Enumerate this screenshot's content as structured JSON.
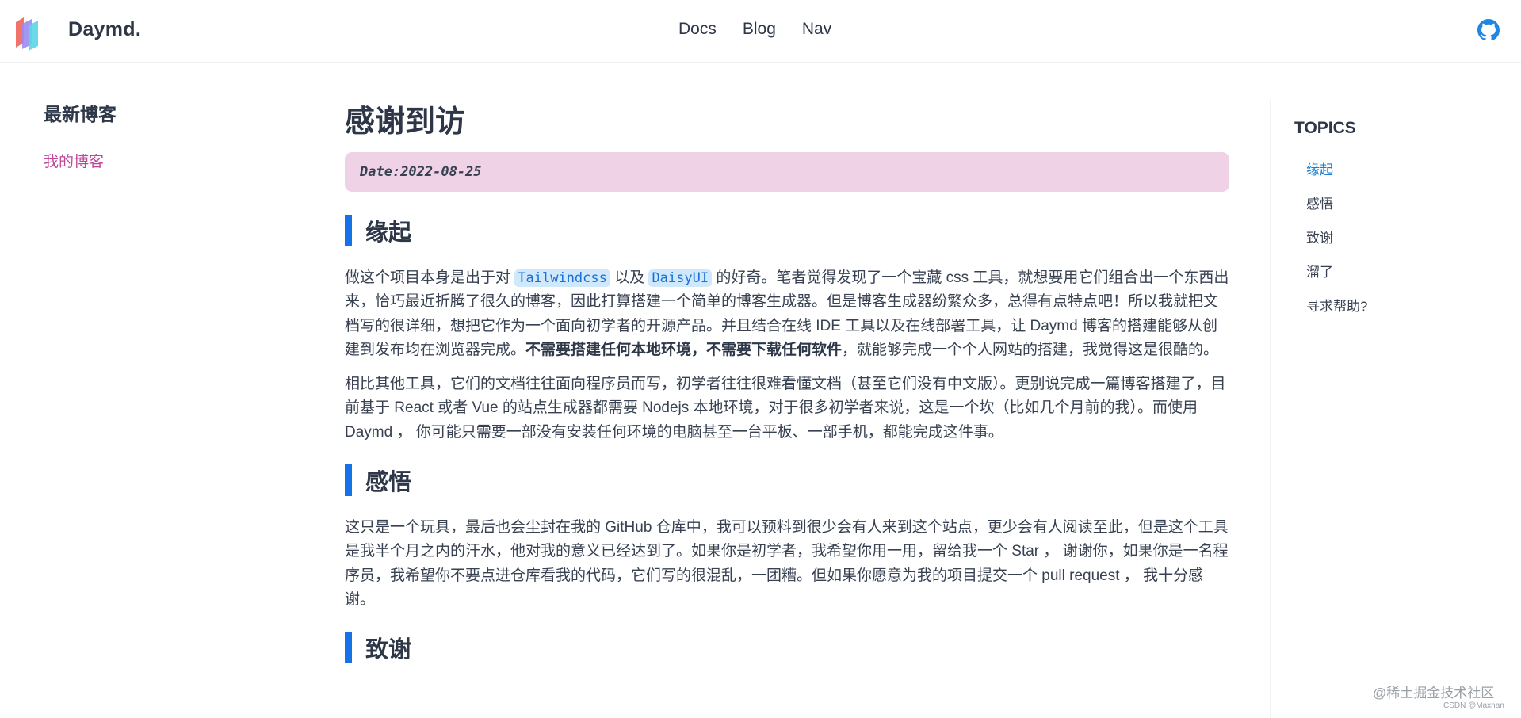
{
  "header": {
    "brand": "Daymd.",
    "nav": [
      "Docs",
      "Blog",
      "Nav"
    ]
  },
  "sidebar": {
    "title": "最新博客",
    "link": "我的博客"
  },
  "article": {
    "title": "感谢到访",
    "date": "Date:2022-08-25",
    "sections": {
      "s1_heading": "缘起",
      "s1_p1_a": "做这个项目本身是出于对 ",
      "s1_code1": "Tailwindcss",
      "s1_p1_b": " 以及 ",
      "s1_code2": "DaisyUI",
      "s1_p1_c": " 的好奇。笔者觉得发现了一个宝藏 css 工具，就想要用它们组合出一个东西出来，恰巧最近折腾了很久的博客，因此打算搭建一个简单的博客生成器。但是博客生成器纷繁众多，总得有点特点吧！所以我就把文档写的很详细，想把它作为一个面向初学者的开源产品。并且结合在线 IDE 工具以及在线部署工具，让 Daymd 博客的搭建能够从创建到发布均在浏览器完成。",
      "s1_p1_strong": "不需要搭建任何本地环境，不需要下载任何软件",
      "s1_p1_d": "，就能够完成一个个人网站的搭建，我觉得这是很酷的。",
      "s1_p2": "相比其他工具，它们的文档往往面向程序员而写，初学者往往很难看懂文档（甚至它们没有中文版）。更别说完成一篇博客搭建了，目前基于 React 或者 Vue 的站点生成器都需要 Nodejs 本地环境，对于很多初学者来说，这是一个坎（比如几个月前的我）。而使用 Daymd ， 你可能只需要一部没有安装任何环境的电脑甚至一台平板、一部手机，都能完成这件事。",
      "s2_heading": "感悟",
      "s2_p1": "这只是一个玩具，最后也会尘封在我的 GitHub 仓库中，我可以预料到很少会有人来到这个站点，更少会有人阅读至此，但是这个工具是我半个月之内的汗水，他对我的意义已经达到了。如果你是初学者，我希望你用一用，留给我一个 Star ， 谢谢你，如果你是一名程序员，我希望你不要点进仓库看我的代码，它们写的很混乱，一团糟。但如果你愿意为我的项目提交一个 pull request ， 我十分感谢。",
      "s3_heading": "致谢"
    }
  },
  "toc": {
    "title": "TOPICS",
    "items": [
      "缘起",
      "感悟",
      "致谢",
      "溜了",
      "寻求帮助?"
    ]
  },
  "watermark": {
    "line1": "@稀土掘金技术社区",
    "line2": "CSDN @Maxnan"
  },
  "colors": {
    "accent": "#1672e6",
    "date_bg": "#f0d2e7",
    "sidebar_link": "#c0469b",
    "code_bg": "#cfe8fc"
  }
}
